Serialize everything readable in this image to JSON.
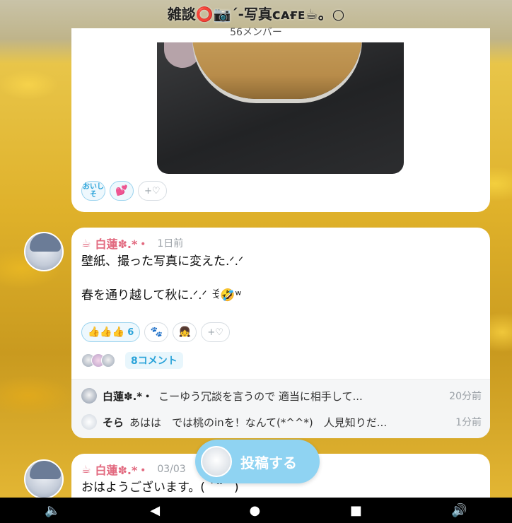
{
  "header": {
    "title": "雑談⭕📷ˊ-写真ᴄᴀғᴇ☕。○",
    "members": "56メンバー"
  },
  "post1": {
    "reactions": [
      {
        "label": "おいしそ",
        "icon": "oishiso-sticker"
      },
      {
        "label": "💕",
        "icon": "hearts-emoji"
      },
      {
        "label": "+♡",
        "icon": "add-reaction-icon"
      }
    ]
  },
  "post2": {
    "author": "白蓮✽.*・",
    "time": "1日前",
    "body": "壁紙、撮った写真に変えた.ᐟ.ᐟ\n\n春を通り越して秋に.ᐟ.ᐟ ꉂ🤣ʷ",
    "reactions": [
      {
        "label": "👍👍👍",
        "count": "6",
        "icon": "thumbs-up-icon"
      },
      {
        "label": "🐾",
        "icon": "character-sticker"
      },
      {
        "label": "👧",
        "icon": "miku-sticker"
      },
      {
        "label": "+♡",
        "icon": "add-reaction-icon"
      }
    ],
    "comment_count_label": "8コメント",
    "comments": [
      {
        "name": "白蓮✽.*・",
        "text": "こーゆう冗談を言うので 適当に相手して...",
        "time": "20分前"
      },
      {
        "name": "そら",
        "text": "あはは　では桃のinを！なんて(*^^*)　人見知りだ...",
        "time": "1分前"
      }
    ]
  },
  "post3": {
    "author": "白蓮✽.*・",
    "time": "03/03",
    "body": "おはようございます。( ˙꒳˙ )"
  },
  "post_button": {
    "label": "投稿する"
  },
  "navbar": {
    "icons": [
      "volume-down-icon",
      "back-icon",
      "home-icon",
      "recents-icon",
      "volume-up-icon"
    ]
  }
}
